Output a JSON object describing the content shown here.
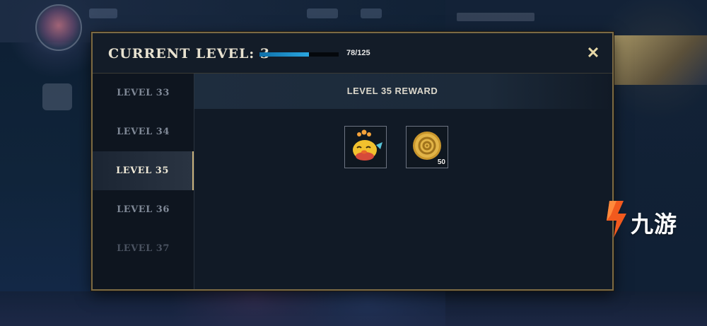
{
  "modal": {
    "title": "CURRENT LEVEL: 3",
    "xp_text": "78/125",
    "xp_progress": 0.624,
    "close_label": "✕"
  },
  "sidebar": {
    "levels": [
      {
        "label": "LEVEL 33",
        "state": "normal"
      },
      {
        "label": "LEVEL 34",
        "state": "normal"
      },
      {
        "label": "LEVEL 35",
        "state": "active"
      },
      {
        "label": "LEVEL 36",
        "state": "normal"
      },
      {
        "label": "LEVEL 37",
        "state": "faded"
      }
    ],
    "scroll_top_icon": "chevron-up-bar-icon"
  },
  "reward": {
    "title": "LEVEL 35 REWARD",
    "items": [
      {
        "icon": "little-legend-chick-icon",
        "quantity": ""
      },
      {
        "icon": "gold-coin-icon",
        "quantity": "50"
      }
    ]
  },
  "watermark": {
    "text": "九游",
    "logo": "nine-game-logo-icon"
  },
  "colors": {
    "accent_gold": "#c8b27c",
    "xp_blue": "#2aa6e0",
    "panel_bg": "#111a26"
  }
}
